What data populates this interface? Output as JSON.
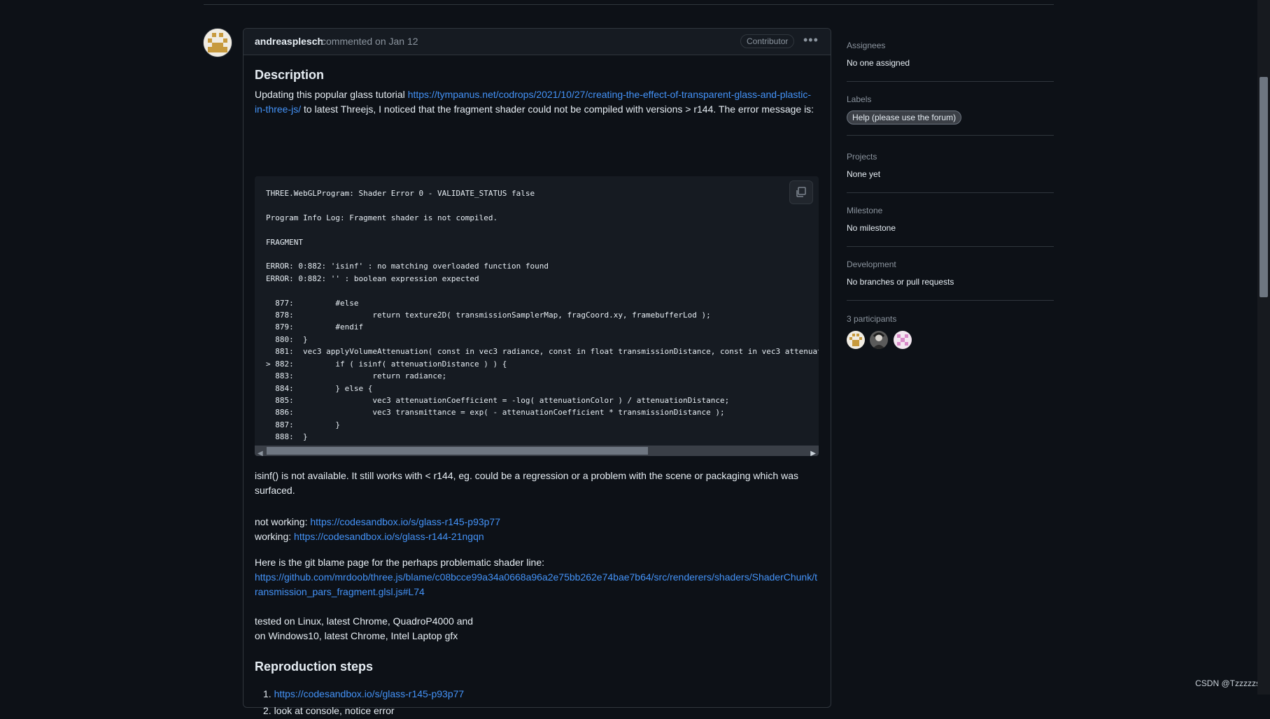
{
  "comment": {
    "author": "andreasplesch",
    "commented_text": "commented on Jan 12",
    "badge": "Contributor",
    "more_icon": "kebab-horizontal-icon",
    "description_heading": "Description",
    "intro_text_before": "Updating this popular glass tutorial ",
    "intro_link": "https://tympanus.net/codrops/2021/10/27/creating-the-effect-of-transparent-glass-and-plastic-in-three-js/",
    "intro_text_after": " to latest Threejs, I noticed that the fragment shader could not be compiled with versions > r144. The error message is:",
    "code": "THREE.WebGLProgram: Shader Error 0 - VALIDATE_STATUS false\n\nProgram Info Log: Fragment shader is not compiled.\n\nFRAGMENT\n\nERROR: 0:882: 'isinf' : no matching overloaded function found\nERROR: 0:882: '' : boolean expression expected\n\n  877:         #else\n  878:                 return texture2D( transmissionSamplerMap, fragCoord.xy, framebufferLod );\n  879:         #endif\n  880:  }\n  881:  vec3 applyVolumeAttenuation( const in vec3 radiance, const in float transmissionDistance, const in vec3 attenuat\n> 882:         if ( isinf( attenuationDistance ) ) {\n  883:                 return radiance;\n  884:         } else {\n  885:                 vec3 attenuationCoefficient = -log( attenuationColor ) / attenuationDistance;\n  886:                 vec3 transmittance = exp( - attenuationCoefficient * transmissionDistance );\n  887:         }\n  888:  }",
    "copy_icon": "copy-icon",
    "isinf_text": "isinf() is not available. It still works with < r144, eg. could be a regression or a problem with the scene or packaging which was surfaced.",
    "not_working_label": "not working: ",
    "not_working_link": "https://codesandbox.io/s/glass-r145-p93p77",
    "working_label": "working: ",
    "working_link": "https://codesandbox.io/s/glass-r144-21ngqn",
    "blame_text": "Here is the git blame page for the perhaps problematic shader line:",
    "blame_link": "https://github.com/mrdoob/three.js/blame/c08bcce99a34a0668a96a2e75bb262e74bae7b64/src/renderers/shaders/ShaderChunk/transmission_pars_fragment.glsl.js#L74",
    "tested_line1": "tested on Linux, latest Chrome, QuadroP4000 and",
    "tested_line2": "on Windows10, latest Chrome, Intel Laptop gfx",
    "repro_heading": "Reproduction steps",
    "repro_steps": [
      "https://codesandbox.io/s/glass-r145-p93p77",
      "look at console, notice error"
    ]
  },
  "sidebar": {
    "assignees_title": "Assignees",
    "assignees_value": "No one assigned",
    "labels_title": "Labels",
    "label": "Help (please use the forum)",
    "projects_title": "Projects",
    "projects_value": "None yet",
    "milestone_title": "Milestone",
    "milestone_value": "No milestone",
    "development_title": "Development",
    "development_value": "No branches or pull requests",
    "participants_title": "3 participants"
  },
  "watermark": "CSDN @Tzzzzzs",
  "colors": {
    "background": "#0d1117",
    "link": "#4493f8",
    "border": "#30363d"
  }
}
